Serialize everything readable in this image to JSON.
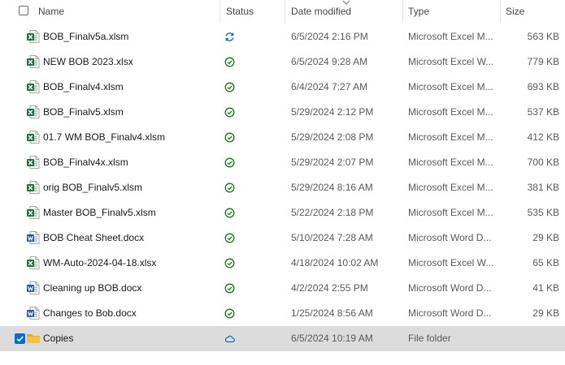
{
  "columns": {
    "name": "Name",
    "status": "Status",
    "date_modified": "Date modified",
    "type": "Type",
    "size": "Size"
  },
  "sort": {
    "column": "date_modified",
    "direction": "descending",
    "icon": "chevron-down-icon"
  },
  "colors": {
    "excel": "#1d6f42",
    "word": "#2b579a",
    "folder": "#f5c342",
    "status_synced": "#107c10",
    "status_syncing": "#0f6cbd",
    "status_cloud": "#0f6cbd",
    "selection": "#dcdcdc",
    "checkbox_checked": "#0f6cbd"
  },
  "files": [
    {
      "name": "BOB_Finalv5a.xlsm",
      "icon": "excel-file-icon",
      "status": "syncing-icon",
      "date": "6/5/2024 2:16 PM",
      "type": "Microsoft Excel M...",
      "size": "563 KB",
      "selected": false
    },
    {
      "name": "NEW BOB 2023.xlsx",
      "icon": "excel-file-icon",
      "status": "synced-check-icon",
      "date": "6/5/2024 9:28 AM",
      "type": "Microsoft Excel W...",
      "size": "779 KB",
      "selected": false
    },
    {
      "name": "BOB_Finalv4.xlsm",
      "icon": "excel-file-icon",
      "status": "synced-check-icon",
      "date": "6/4/2024 7:27 AM",
      "type": "Microsoft Excel M...",
      "size": "693 KB",
      "selected": false
    },
    {
      "name": "BOB_Finalv5.xlsm",
      "icon": "excel-file-icon",
      "status": "synced-check-icon",
      "date": "5/29/2024 2:12 PM",
      "type": "Microsoft Excel M...",
      "size": "537 KB",
      "selected": false
    },
    {
      "name": "01.7 WM BOB_Finalv4.xlsm",
      "icon": "excel-file-icon",
      "status": "synced-check-icon",
      "date": "5/29/2024 2:08 PM",
      "type": "Microsoft Excel M...",
      "size": "412 KB",
      "selected": false
    },
    {
      "name": "BOB_Finalv4x.xlsm",
      "icon": "excel-file-icon",
      "status": "synced-check-icon",
      "date": "5/29/2024 2:07 PM",
      "type": "Microsoft Excel M...",
      "size": "700 KB",
      "selected": false
    },
    {
      "name": "orig BOB_Finalv5.xlsm",
      "icon": "excel-file-icon",
      "status": "synced-check-icon",
      "date": "5/29/2024 8:16 AM",
      "type": "Microsoft Excel M...",
      "size": "381 KB",
      "selected": false
    },
    {
      "name": "Master BOB_Finalv5.xlsm",
      "icon": "excel-file-icon",
      "status": "synced-check-icon",
      "date": "5/22/2024 2:18 PM",
      "type": "Microsoft Excel M...",
      "size": "535 KB",
      "selected": false
    },
    {
      "name": "BOB Cheat Sheet.docx",
      "icon": "word-file-icon",
      "status": "synced-check-icon",
      "date": "5/10/2024 7:28 AM",
      "type": "Microsoft Word D...",
      "size": "29 KB",
      "selected": false
    },
    {
      "name": "WM-Auto-2024-04-18.xlsx",
      "icon": "excel-file-icon",
      "status": "synced-check-icon",
      "date": "4/18/2024 10:02 AM",
      "type": "Microsoft Excel W...",
      "size": "65 KB",
      "selected": false
    },
    {
      "name": "Cleaning up BOB.docx",
      "icon": "word-file-icon",
      "status": "synced-check-icon",
      "date": "4/2/2024 2:55 PM",
      "type": "Microsoft Word D...",
      "size": "41 KB",
      "selected": false
    },
    {
      "name": "Changes to Bob.docx",
      "icon": "word-file-icon",
      "status": "synced-check-icon",
      "date": "1/25/2024 8:56 AM",
      "type": "Microsoft Word D...",
      "size": "29 KB",
      "selected": false
    },
    {
      "name": "Copies",
      "icon": "folder-icon",
      "status": "cloud-icon",
      "date": "6/5/2024 10:19 AM",
      "type": "File folder",
      "size": "",
      "selected": true
    }
  ]
}
